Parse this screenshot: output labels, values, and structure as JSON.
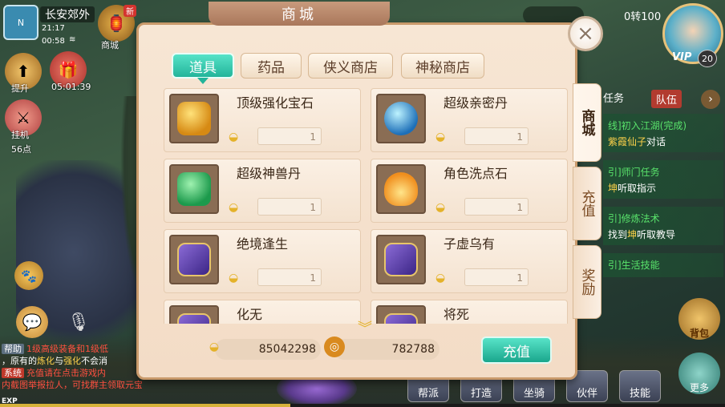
{
  "hud": {
    "location": "长安郊外",
    "time_a": "21:17",
    "time_b": "00:58",
    "shop_label": "商城",
    "new_tag": "新",
    "lift_label": "提升",
    "gift_timer": "05:01:39",
    "guaji_label": "挂机",
    "points": "56点",
    "zhuan": "0转100",
    "vip_label": "VIP",
    "vip_level": "20",
    "exp_label": "EXP"
  },
  "quest": {
    "task_tab": "任务",
    "team_tab": "队伍",
    "items": [
      {
        "line1": "线]初入江湖(完成)",
        "line2_pre": "",
        "line2_hl": "紫霞仙子",
        "line2_post": "对话"
      },
      {
        "line1": "引]师门任务",
        "line2_pre": "",
        "line2_hl": "坤",
        "line2_post": "听取指示"
      },
      {
        "line1": "引]修炼法术",
        "line2_pre": "找到",
        "line2_hl": "坤",
        "line2_post": "听取教导"
      },
      {
        "line1": "引]生活技能",
        "line2_pre": "",
        "line2_hl": "",
        "line2_post": ""
      }
    ]
  },
  "bottom_bar": {
    "items": [
      "帮派",
      "打造",
      "坐骑",
      "伙伴",
      "技能"
    ],
    "bag": "背包",
    "more": "更多"
  },
  "chat": {
    "help_channel": "帮助",
    "help_text": "1级高级装备和1级低",
    "line2_pre": "，原有的",
    "line2_hl1": "炼化",
    "line2_mid": "与",
    "line2_hl2": "强化",
    "line2_post": "不会消",
    "sys_channel": "系统",
    "sys_text": "充值请在点击游戏内",
    "sys_text2": "内截图举报拉人，可找群主领取元宝奖励"
  },
  "shop": {
    "title": "商城",
    "close_symbol": "×",
    "tabs": [
      "道具",
      "药品",
      "侠义商店",
      "神秘商店"
    ],
    "side_tabs": [
      "商城",
      "充值",
      "奖励"
    ],
    "items": [
      {
        "name": "顶级强化宝石",
        "icon": "gem-icon",
        "qty": "1"
      },
      {
        "name": "超级亲密丹",
        "icon": "orb-icon",
        "qty": "1"
      },
      {
        "name": "超级神兽丹",
        "icon": "jade-icon",
        "qty": "1"
      },
      {
        "name": "角色洗点石",
        "icon": "fire-icon",
        "qty": "1"
      },
      {
        "name": "绝境逢生",
        "icon": "book-icon",
        "qty": "1"
      },
      {
        "name": "子虚乌有",
        "icon": "book-icon",
        "qty": "1"
      },
      {
        "name": "化无",
        "icon": "book-icon",
        "qty": ""
      },
      {
        "name": "将死",
        "icon": "book-icon",
        "qty": ""
      }
    ],
    "ingot_balance": "85042298",
    "coin_balance": "782788",
    "recharge_label": "充值"
  },
  "colors": {
    "accent": "#23b49a",
    "panel": "#f3dcc6",
    "gold": "#e4b22a"
  }
}
